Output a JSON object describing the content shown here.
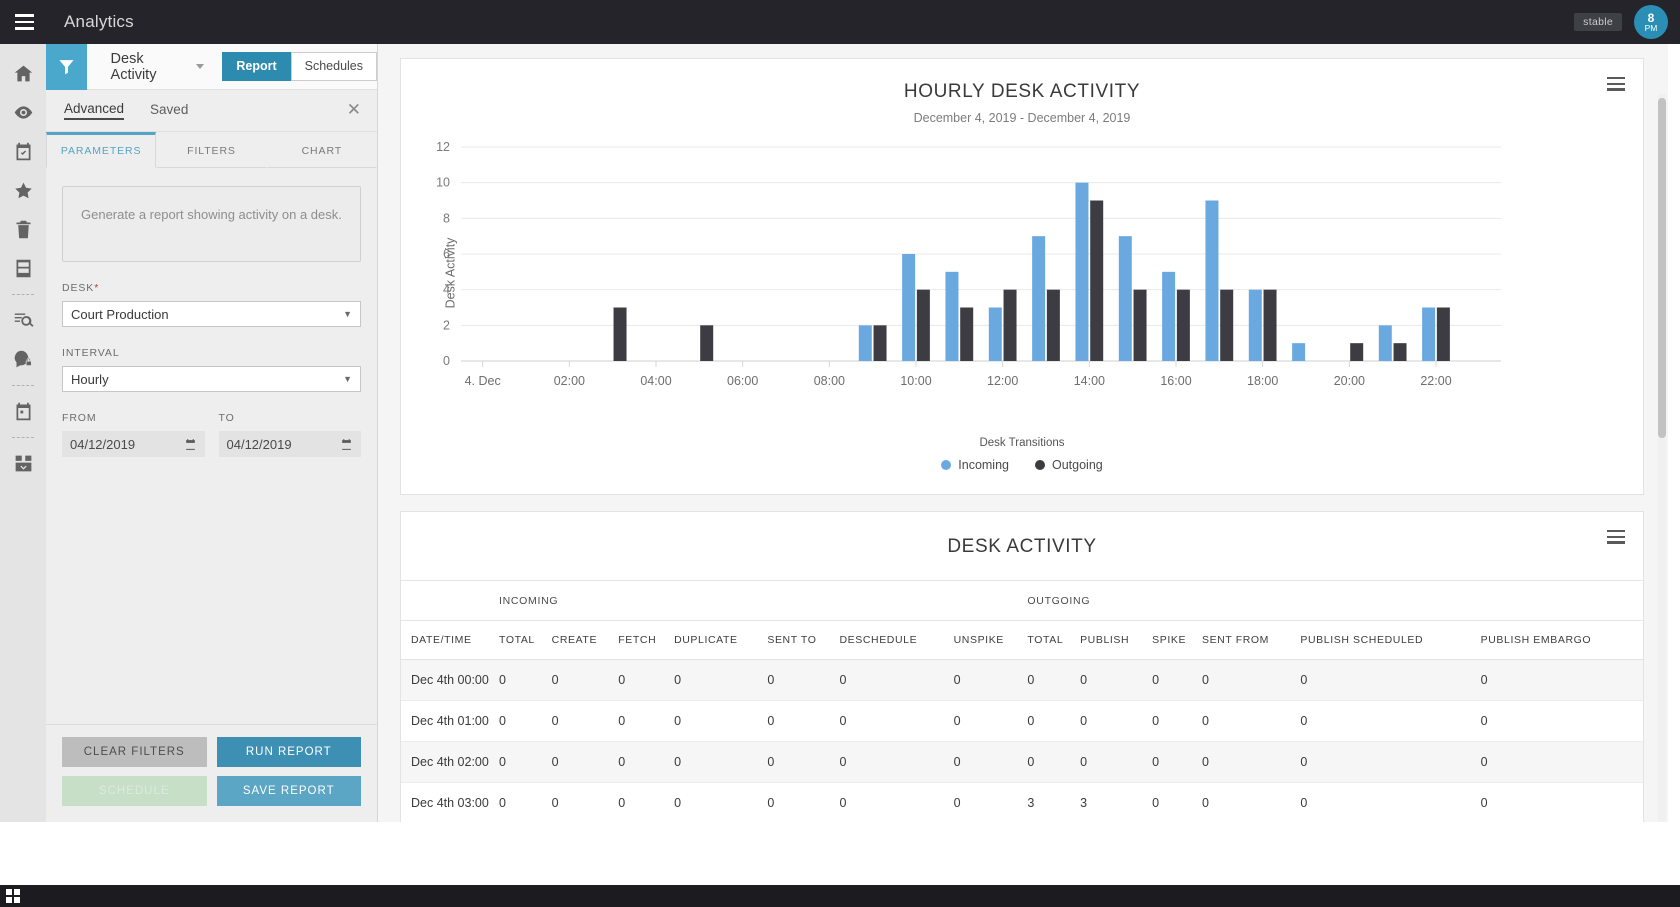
{
  "topbar": {
    "menu_icon": "hamburger-icon",
    "title": "Analytics",
    "env_badge": "stable",
    "clock_hour": "8",
    "clock_meridiem": "PM"
  },
  "rail": {
    "items": [
      {
        "icon": "home-icon",
        "name": "home"
      },
      {
        "icon": "eye-icon",
        "name": "watch"
      },
      {
        "icon": "calendar-check-icon",
        "name": "tasks"
      },
      {
        "icon": "star-icon",
        "name": "favorites"
      },
      {
        "icon": "trash-icon",
        "name": "trash"
      },
      {
        "icon": "archive-cabinet-icon",
        "name": "archive"
      },
      {
        "icon": "divider",
        "name": "divider-1"
      },
      {
        "icon": "search-list-icon",
        "name": "search"
      },
      {
        "icon": "user-lock-icon",
        "name": "permissions"
      },
      {
        "icon": "divider",
        "name": "divider-2"
      },
      {
        "icon": "calendar-icon",
        "name": "calendar"
      },
      {
        "icon": "divider",
        "name": "divider-3"
      },
      {
        "icon": "inbox-download-icon",
        "name": "ingest"
      }
    ]
  },
  "panel": {
    "filter_icon": "funnel-icon",
    "report_name": "Desk Activity",
    "segments": [
      {
        "label": "Report",
        "active": true
      },
      {
        "label": "Schedules",
        "active": false
      }
    ],
    "tabs": [
      {
        "label": "Advanced",
        "active": true
      },
      {
        "label": "Saved",
        "active": false
      }
    ],
    "close_icon": "close-icon",
    "close_glyph": "✕",
    "subtabs": [
      {
        "label": "PARAMETERS",
        "active": true
      },
      {
        "label": "FILTERS",
        "active": false
      },
      {
        "label": "CHART",
        "active": false
      }
    ],
    "description": "Generate a report showing activity on a desk.",
    "fields": {
      "desk_label": "DESK",
      "desk_required": "*",
      "desk_value": "Court Production",
      "interval_label": "INTERVAL",
      "interval_value": "Hourly",
      "from_label": "FROM",
      "from_value": "04/12/2019",
      "to_label": "TO",
      "to_value": "04/12/2019",
      "calendar_icon": "calendar-icon",
      "dropdown_glyph": "▼"
    },
    "buttons": {
      "clear_filters": "CLEAR FILTERS",
      "run_report": "RUN REPORT",
      "schedule": "SCHEDULE",
      "save_report": "SAVE REPORT"
    }
  },
  "chart_card": {
    "menu_icon": "hamburger-menu-icon"
  },
  "table_card": {
    "menu_icon": "hamburger-menu-icon",
    "title": "DESK ACTIVITY",
    "group_headers": [
      {
        "label": "INCOMING",
        "span": 7
      },
      {
        "label": "OUTGOING",
        "span": 6
      }
    ],
    "columns": [
      "DATE/TIME",
      "TOTAL",
      "CREATE",
      "FETCH",
      "DUPLICATE",
      "SENT TO",
      "DESCHEDULE",
      "UNSPIKE",
      "TOTAL",
      "PUBLISH",
      "SPIKE",
      "SENT FROM",
      "PUBLISH SCHEDULED",
      "PUBLISH EMBARGO"
    ],
    "rows": [
      [
        "Dec 4th 00:00",
        "0",
        "0",
        "0",
        "0",
        "0",
        "0",
        "0",
        "0",
        "0",
        "0",
        "0",
        "0",
        "0"
      ],
      [
        "Dec 4th 01:00",
        "0",
        "0",
        "0",
        "0",
        "0",
        "0",
        "0",
        "0",
        "0",
        "0",
        "0",
        "0",
        "0"
      ],
      [
        "Dec 4th 02:00",
        "0",
        "0",
        "0",
        "0",
        "0",
        "0",
        "0",
        "0",
        "0",
        "0",
        "0",
        "0",
        "0"
      ],
      [
        "Dec 4th 03:00",
        "0",
        "0",
        "0",
        "0",
        "0",
        "0",
        "0",
        "3",
        "3",
        "0",
        "0",
        "0",
        "0"
      ]
    ]
  },
  "chart_data": {
    "type": "bar",
    "title": "HOURLY DESK ACTIVITY",
    "subtitle": "December 4, 2019 - December 4, 2019",
    "xlabel": "",
    "ylabel": "Desk Activity",
    "ylim": [
      0,
      12
    ],
    "yticks": [
      0,
      2,
      4,
      6,
      8,
      10,
      12
    ],
    "grid": true,
    "legend_title": "Desk Transitions",
    "legend_position": "bottom",
    "categories": [
      "4. Dec",
      "01:00",
      "02:00",
      "03:00",
      "04:00",
      "05:00",
      "06:00",
      "07:00",
      "08:00",
      "09:00",
      "10:00",
      "11:00",
      "12:00",
      "13:00",
      "14:00",
      "15:00",
      "16:00",
      "17:00",
      "18:00",
      "19:00",
      "20:00",
      "21:00",
      "22:00",
      "23:00"
    ],
    "xtick_labels": [
      "4. Dec",
      "02:00",
      "04:00",
      "06:00",
      "08:00",
      "10:00",
      "12:00",
      "14:00",
      "16:00",
      "18:00",
      "20:00",
      "22:00"
    ],
    "series": [
      {
        "name": "Incoming",
        "color": "#6aa9e0",
        "values": [
          0,
          0,
          0,
          0,
          0,
          0,
          0,
          0,
          0,
          2,
          6,
          5,
          3,
          7,
          10,
          7,
          5,
          9,
          4,
          1,
          0,
          2,
          3,
          0
        ]
      },
      {
        "name": "Outgoing",
        "color": "#3c3c42",
        "values": [
          0,
          0,
          0,
          3,
          0,
          2,
          0,
          0,
          0,
          2,
          4,
          3,
          4,
          4,
          9,
          4,
          4,
          4,
          4,
          0,
          1,
          1,
          3,
          0
        ]
      }
    ]
  }
}
